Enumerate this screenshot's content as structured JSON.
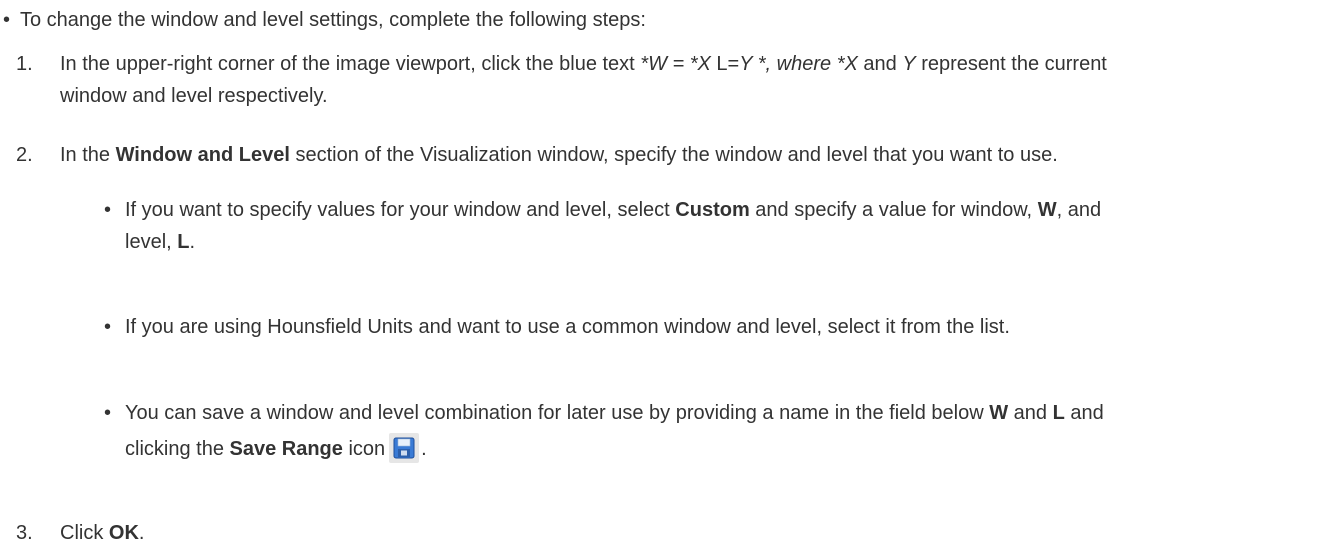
{
  "intro": {
    "bullet": "•",
    "text": "To change the window and level settings, complete the following steps:"
  },
  "step1": {
    "number": "1.",
    "t1": "In the upper-right corner of the image viewport, click the blue text ",
    "t2": "*W = *X",
    "t3": " L=",
    "t4": "Y *, where *X",
    "t5": " and ",
    "t6": "Y",
    "t7": " represent the current",
    "line2": "window and level respectively."
  },
  "step2": {
    "number": "2.",
    "t1": "In the ",
    "t2": "Window and Level",
    "t3": " section of the Visualization window, specify the window and level that you want to use."
  },
  "sub1": {
    "bullet": "•",
    "t1": "If you want to specify values for your window and level, select ",
    "t2": "Custom",
    "t3": " and specify a value for window, ",
    "t4": "W",
    "t5": ", and",
    "l2a": "level, ",
    "l2b": "L",
    "l2c": "."
  },
  "sub2": {
    "bullet": "•",
    "text": "If you are using Hounsfield Units and want to use a common window and level, select it from the list."
  },
  "sub3": {
    "bullet": "•",
    "t1": "You can save a window and level combination for later use by providing a name in the field below ",
    "t2": "W",
    "t3": " and ",
    "t4": "L",
    "t5": " and",
    "l2a": "clicking the ",
    "l2b": "Save Range",
    "l2c": " icon",
    "l2d": ".",
    "icon": "save-floppy-icon"
  },
  "step3": {
    "number": "3.",
    "t1": "Click ",
    "t2": "OK",
    "t3": "."
  }
}
